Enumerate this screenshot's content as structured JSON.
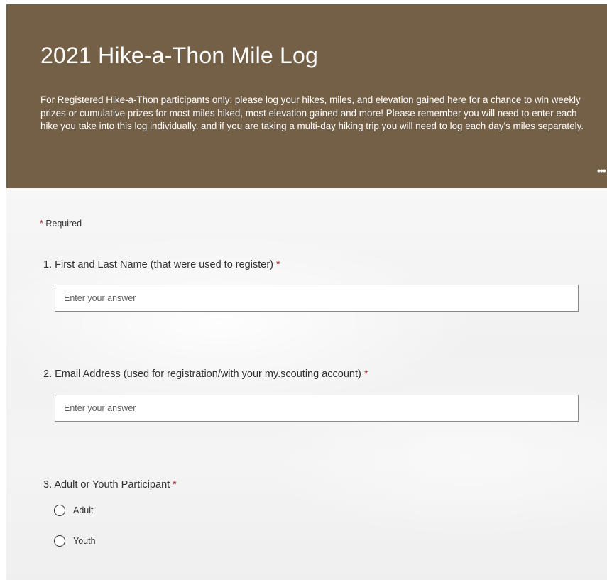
{
  "header": {
    "title": "2021 Hike-a-Thon Mile Log",
    "description": "For Registered Hike-a-Thon participants only: please log your hikes, miles, and elevation gained here for a chance to win weekly prizes or cumulative prizes for most miles hiked, most elevation gained and more! Please remember you will need to enter each hike you take into this log individually, and if you are taking a multi-day hiking trip you will need to log each day's miles separately.",
    "more_icon": "more-dots-icon",
    "more_label": "•••",
    "background_color": "#745f47"
  },
  "required_note": {
    "star": "*",
    "label": "Required"
  },
  "questions": [
    {
      "title": "1. First and Last Name (that were used to register)",
      "star": "*",
      "placeholder": "Enter your answer",
      "value": ""
    },
    {
      "title": "2. Email Address (used for registration/with your my.scouting account)",
      "star": "*",
      "placeholder": "Enter your answer",
      "value": ""
    },
    {
      "title": "3. Adult or Youth Participant",
      "star": "*",
      "options": [
        "Adult",
        "Youth"
      ]
    }
  ],
  "colors": {
    "required_star": "#a4262c",
    "text": "#323130"
  }
}
